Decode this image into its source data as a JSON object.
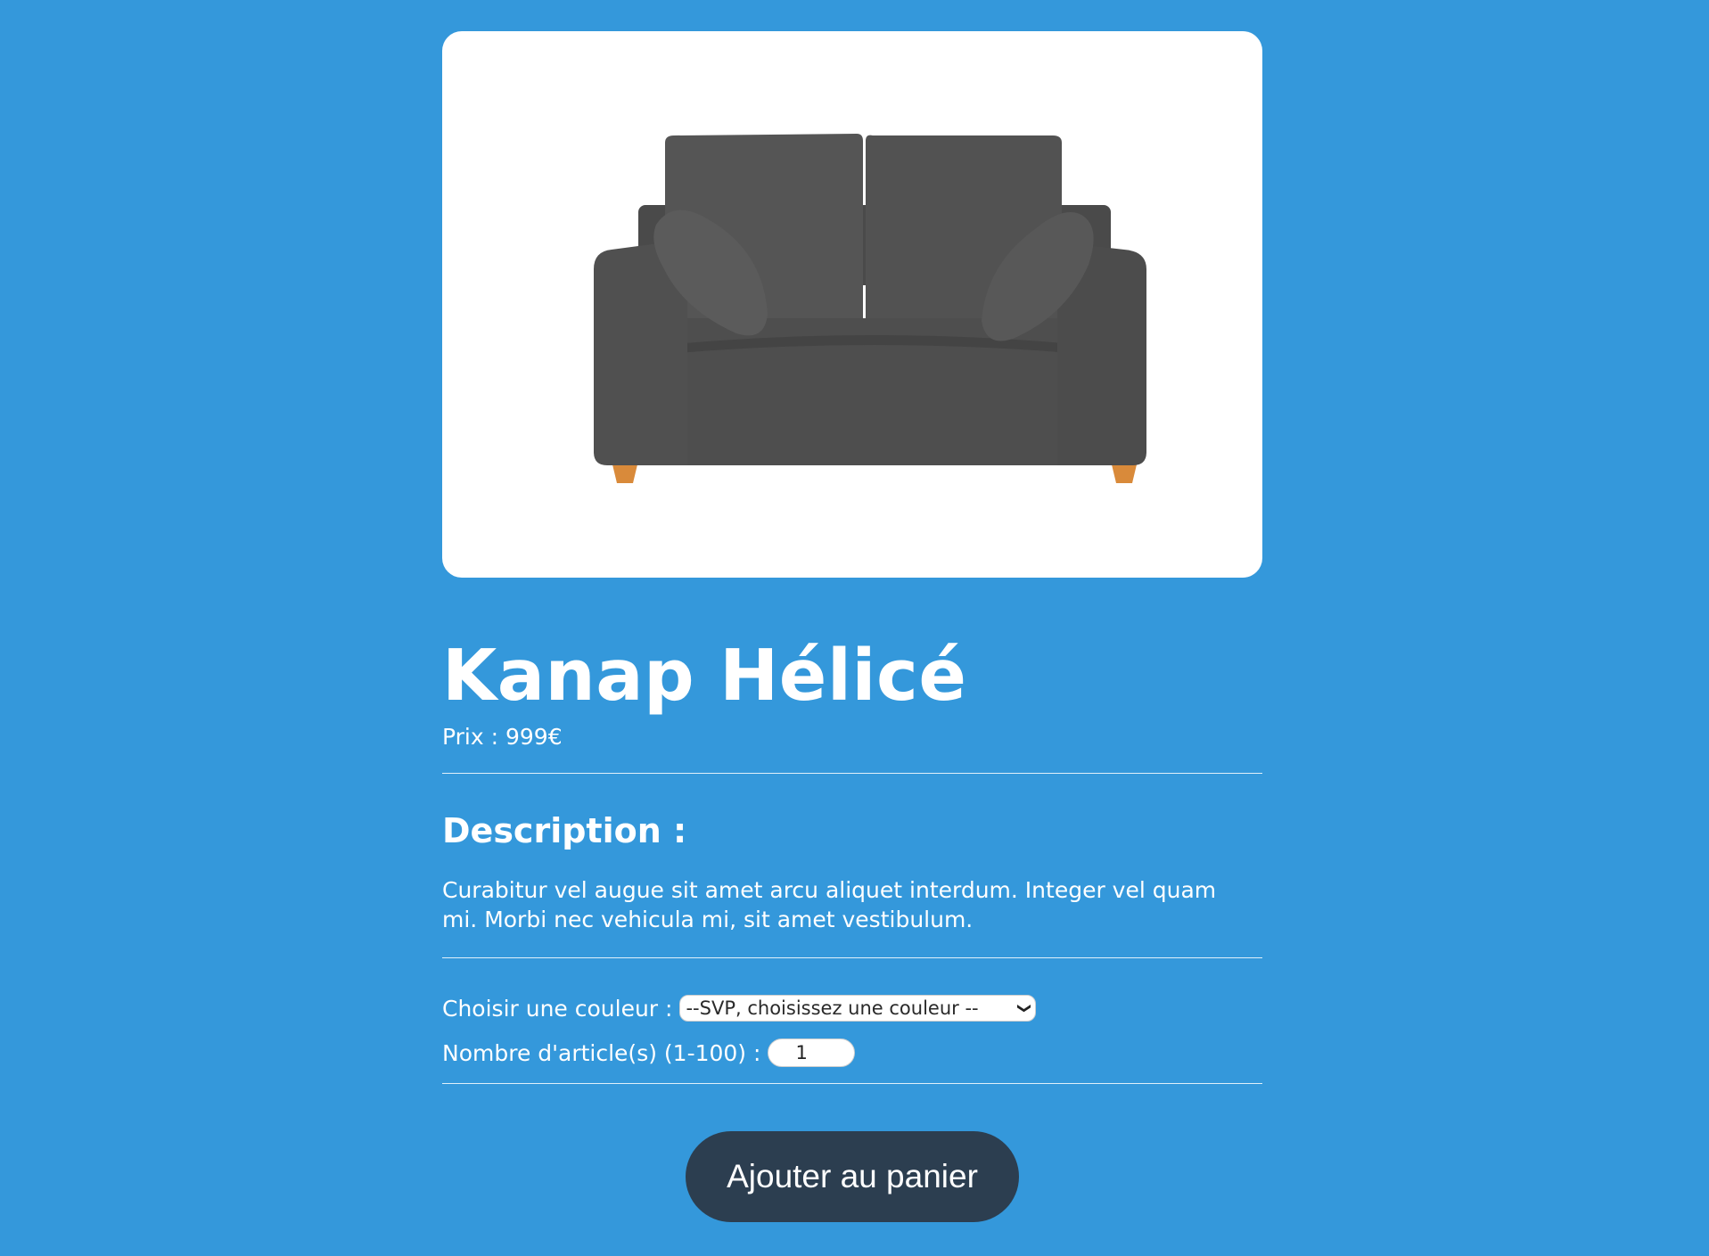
{
  "product": {
    "image_alt": "Kanap Hélicé",
    "name": "Kanap Hélicé",
    "price_label": "Prix : ",
    "price_value": "999",
    "currency": "€",
    "description_title": "Description :",
    "description": "Curabitur vel augue sit amet arcu aliquet interdum. Integer vel quam mi. Morbi nec vehicula mi, sit amet vestibulum."
  },
  "settings": {
    "color_label": "Choisir une couleur : ",
    "color_selected": "--SVP, choisissez une couleur --",
    "quantity_label": "Nombre d'article(s) (1-100) : ",
    "quantity_value": "1"
  },
  "actions": {
    "add_to_cart": "Ajouter au panier"
  },
  "colors": {
    "background": "#3498db",
    "button": "#2c3e50",
    "card": "#ffffff"
  }
}
